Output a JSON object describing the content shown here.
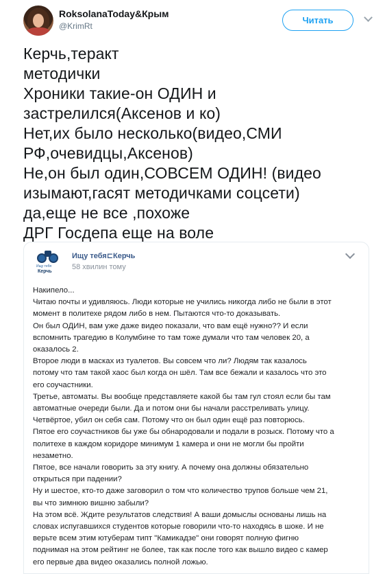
{
  "tweet": {
    "author": {
      "display_name": "RoksolanaToday&Крым",
      "handle": "@KrimRt",
      "avatar_icon": "user-avatar-photo"
    },
    "follow_label": "Читать",
    "more_icon": "chevron-down-icon",
    "text_lines": [
      "Керчь,теракт",
      "методички",
      "Хроники такие-он ОДИН и",
      "застрелился(Аксенов и ко)",
      "Нет,их было несколько(видео,СМИ",
      "РФ,очевидцы,Аксенов)",
      "Не,он был один,СОВСЕМ ОДИН! (видео",
      "изымают,гасят методичками соцсети)",
      "да,еще не все ,похоже",
      "ДРГ Госдепа еще на воле"
    ]
  },
  "embedded_post": {
    "group_logo": {
      "icon": "binoculars-icon",
      "caption": "Ищу тебя",
      "city": "Керчь"
    },
    "group_name": "Ищу тебя⊏Керчь",
    "time": "58 хвилин тому",
    "menu_icon": "chevron-down-icon",
    "body_lines": [
      "Накипело...",
      "Читаю почты и удивляюсь. Люди которые не учились никогда либо не были в этот",
      "момент в политехе рядом либо в нем. Пытаются что-то доказывать.",
      "Он был ОДИН, вам уже даже видео показали, что вам ещё нужно?? И если",
      "вспомнить трагедию в Колумбине то там тоже думали что там человек 20, а",
      "оказалось 2.",
      "Второе люди в масках из туалетов. Вы совсем что ли? Людям так казалось",
      "потому что там такой хаос был когда он шёл. Там все бежали и казалось что это",
      "его соучастники.",
      "Третье, автоматы. Вы вообще представляете какой бы там гул стоял если бы там",
      "автоматные очереди были. Да и потом они бы начали расстреливать улицу.",
      "Четвёртое, убил он себя сам. Потому что он был один ещё раз повторюсь.",
      "Пятое его соучастников бы уже бы обнародовали и подали в розыск. Потому что а",
      "политехе в каждом коридоре минимум 1 камера и они не могли бы пройти",
      "незаметно.",
      "Пятое, все начали говорить за эту книгу. А почему она должны обязательно",
      "открыться при падении?",
      "Ну и шестое, кто-то даже заговорил о том что количество трупов больше чем 21,",
      "вы что зимнюю вишню забыли?",
      "На этом всё. Ждите результатов следствия! А ваши домыслы основаны лишь на",
      "словах испугавшихся студентов которые говорили что-то находясь в шоке. И не",
      "верьте всем этим ютуберам типт \"Камикадзе\" они говорят полную фигню",
      "поднимая на этом рейтинг не более, так как после того как вышло видео с камер",
      "его первые два видео оказались полной ложью."
    ]
  }
}
